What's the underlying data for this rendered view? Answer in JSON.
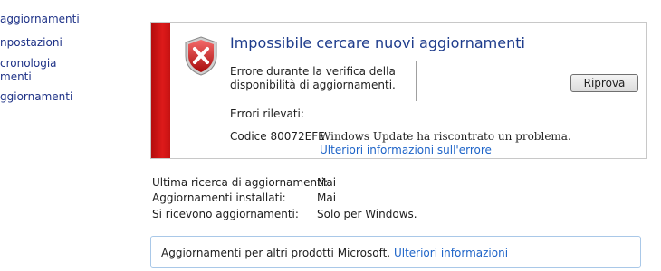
{
  "sidebar": {
    "items": [
      {
        "label": "aggiornamenti"
      },
      {
        "label": "npostazioni"
      },
      {
        "label": "cronologia\nmenti"
      },
      {
        "label": "ggiornamenti"
      }
    ]
  },
  "error_panel": {
    "icon": "shield-error-icon",
    "title": "Impossibile cercare nuovi aggiornamenti",
    "description": "Errore durante la verifica della disponibilità di aggiornamenti.",
    "retry_label": "Riprova",
    "errors_label": "Errori rilevati:",
    "code": "Codice 80072EFE",
    "message": "Windows Update ha riscontrato un problema.",
    "more_link": "Ulteriori informazioni sull'errore",
    "accent_color": "#c8102e"
  },
  "status": {
    "rows": [
      {
        "label": "Ultima ricerca di aggiornamenti:",
        "value": "Mai"
      },
      {
        "label": "Aggiornamenti installati:",
        "value": "Mai"
      },
      {
        "label": "Si ricevono aggiornamenti:",
        "value": "Solo per Windows."
      }
    ]
  },
  "other_products": {
    "text": "Aggiornamenti per altri prodotti Microsoft.",
    "link": "Ulteriori informazioni"
  }
}
